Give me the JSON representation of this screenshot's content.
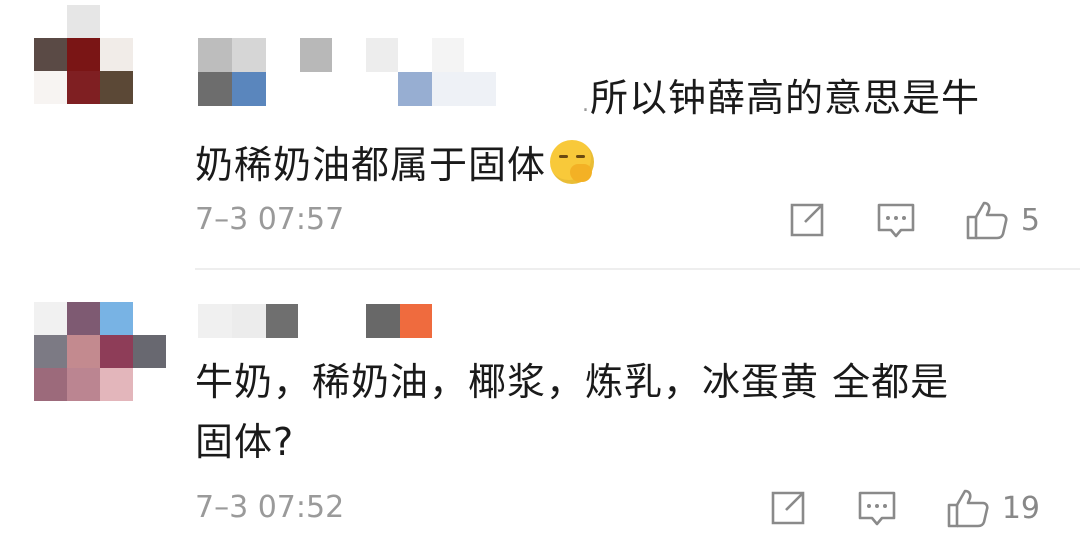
{
  "comments": [
    {
      "prefix": ".",
      "text": "所以钟薛高的意思是牛",
      "text2": "奶稀奶油都属于固体",
      "emoji": "smirk-hand-over-mouth-emoji",
      "time": "7–3 07:57",
      "likes": "5"
    },
    {
      "text": "牛奶，稀奶油，椰浆，炼乳，冰蛋黄 全都是",
      "text2": "固体?",
      "time": "7–3 07:52",
      "likes": "19"
    }
  ],
  "icons": {
    "share": "share-icon",
    "reply": "comment-icon",
    "like": "thumbs-up-icon"
  },
  "colors": {
    "time": "#9a9a9a",
    "icon": "#8a8a8a",
    "divider": "#eeeeee"
  }
}
